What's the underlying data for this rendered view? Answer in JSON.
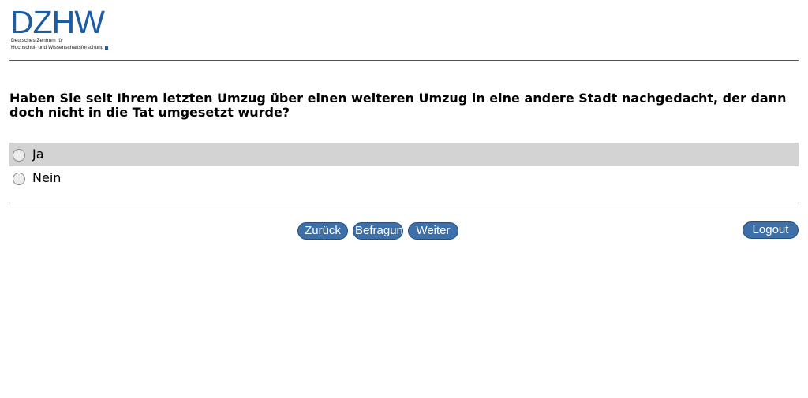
{
  "logo": {
    "wordmark": "DZHW",
    "line1": "Deutsches Zentrum für",
    "line2": "Hochschul- und Wissenschaftsforschung"
  },
  "question": {
    "text": "Haben Sie seit Ihrem letzten Umzug über einen weiteren Umzug in eine andere Stadt nachgedacht, der dann doch nicht in die Tat umgesetzt wurde?"
  },
  "options": [
    {
      "label": "Ja",
      "selected": false
    },
    {
      "label": "Nein",
      "selected": false
    }
  ],
  "navigation": {
    "back_label": "Zurück",
    "survey_label": "Befragung",
    "next_label": "Weiter",
    "logout_label": "Logout"
  },
  "colors": {
    "brand": "#1b5ca6",
    "button": "#3d6fa8",
    "highlight_row": "#d3d3d3"
  }
}
